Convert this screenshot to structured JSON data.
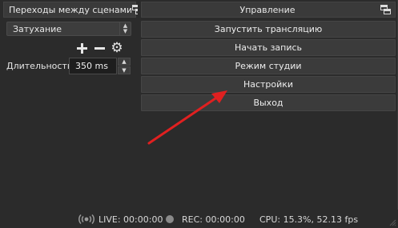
{
  "transitions": {
    "title": "Переходы между сценами",
    "combo_value": "Затухание",
    "duration_label": "Длительность",
    "duration_value": "350 ms"
  },
  "controls": {
    "title": "Управление",
    "buttons": [
      "Запустить трансляцию",
      "Начать запись",
      "Режим студии",
      "Настройки",
      "Выход"
    ]
  },
  "status": {
    "live": "LIVE: 00:00:00",
    "rec": "REC: 00:00:00",
    "cpu": "CPU: 15.3%, 52.13 fps"
  },
  "annotation": {
    "color": "#e02020"
  },
  "icons": {
    "undock": "undock-icon",
    "add": "plus-icon",
    "remove": "minus-icon",
    "settings": "gear-icon",
    "live": "broadcast-icon",
    "rec": "record-dot-icon"
  }
}
